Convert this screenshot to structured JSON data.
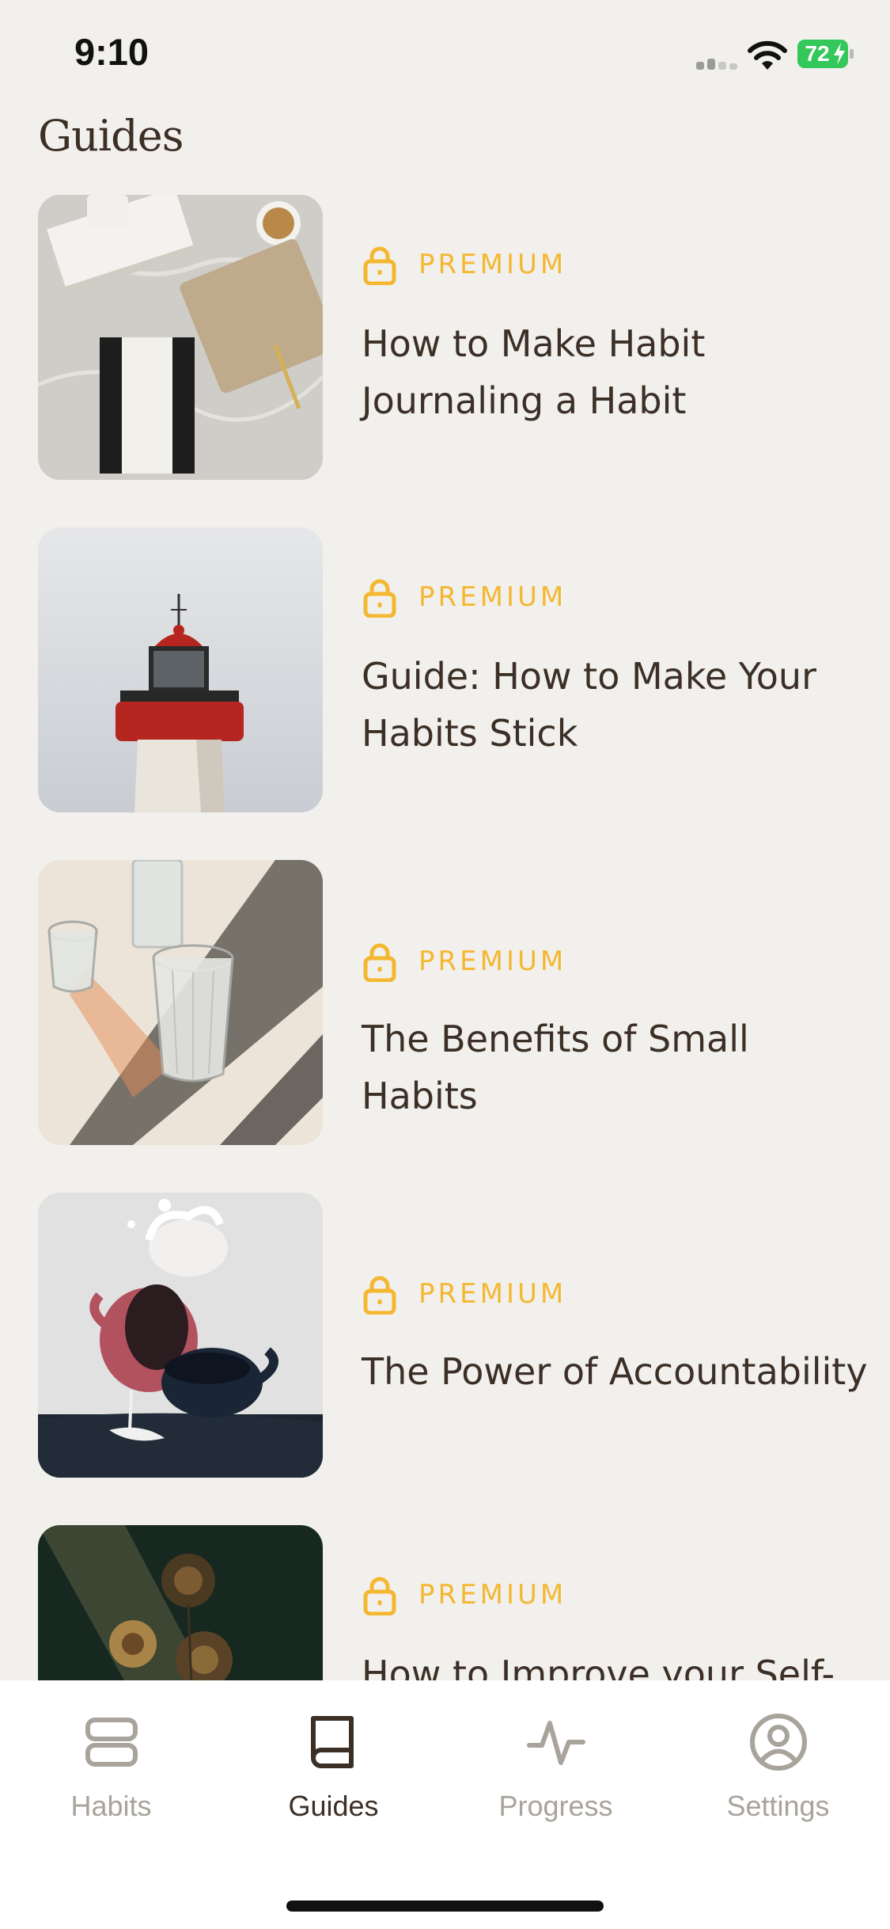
{
  "status_bar": {
    "time": "9:10",
    "battery": "72"
  },
  "header": {
    "title": "Guides"
  },
  "guides": [
    {
      "badge": "PREMIUM",
      "title": "How to Make Habit Journaling a Habit",
      "image": "notebooks-on-marble-photo"
    },
    {
      "badge": "PREMIUM",
      "title": "Guide: How to Make Your Habits Stick",
      "image": "lighthouse-photo"
    },
    {
      "badge": "PREMIUM",
      "title": "The Benefits of Small Habits",
      "image": "glasses-in-sunlight-photo"
    },
    {
      "badge": "PREMIUM",
      "title": "The Power of Accountability",
      "image": "falling-cups-photo"
    },
    {
      "badge": "PREMIUM",
      "title": "How to Improve your Self-",
      "image": "dried-flowers-photo"
    }
  ],
  "tab_bar": {
    "tabs": [
      {
        "label": "Habits",
        "icon": "stacked-rectangles-icon",
        "active": false
      },
      {
        "label": "Guides",
        "icon": "book-icon",
        "active": true
      },
      {
        "label": "Progress",
        "icon": "pulse-icon",
        "active": false
      },
      {
        "label": "Settings",
        "icon": "person-circle-icon",
        "active": false
      }
    ]
  },
  "colors": {
    "background": "#f2f0ec",
    "premium": "#f4b731",
    "text": "#3b2f26",
    "inactive_tab": "#a8a49c"
  }
}
